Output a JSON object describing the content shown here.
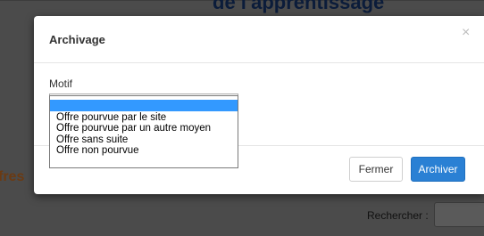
{
  "background": {
    "heading": "de l'apprentissage",
    "side_text": "fres",
    "search_label": "Rechercher :"
  },
  "modal": {
    "title": "Archivage",
    "close_symbol": "×",
    "motif_label": "Motif",
    "select": {
      "selected_value": "",
      "options": [
        "",
        "Offre pourvue par le site",
        "Offre pourvue par un autre moyen",
        "Offre sans suite",
        "Offre non pourvue"
      ]
    },
    "buttons": {
      "close_label": "Fermer",
      "archive_label": "Archiver"
    }
  },
  "colors": {
    "primary": "#2a80d4",
    "highlight": "#3399ff",
    "overlay": "#4b4b4b"
  }
}
